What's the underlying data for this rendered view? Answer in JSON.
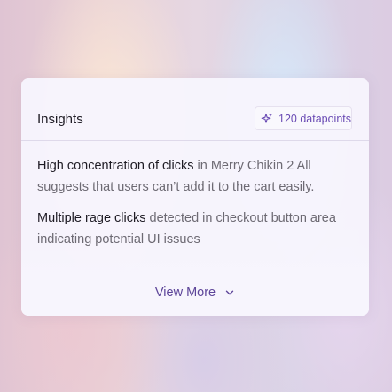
{
  "card": {
    "title": "Insights",
    "badge": {
      "icon": "sparkle-icon",
      "label": "120 datapoints"
    },
    "insights": [
      {
        "highlight": "High concentration of clicks",
        "text": " in Merry Chikin 2 All suggests that users can’t add it to the cart easily."
      },
      {
        "highlight": "Multiple rage clicks",
        "text": " detected in checkout button area indicating potential UI issues"
      }
    ],
    "view_more": {
      "label": "View More",
      "icon": "chevron-down-icon"
    }
  },
  "colors": {
    "accent": "#5d4599",
    "badge_text": "#6a4bb4",
    "text_strong": "#1e1b24",
    "text_muted": "#6d6a73"
  }
}
